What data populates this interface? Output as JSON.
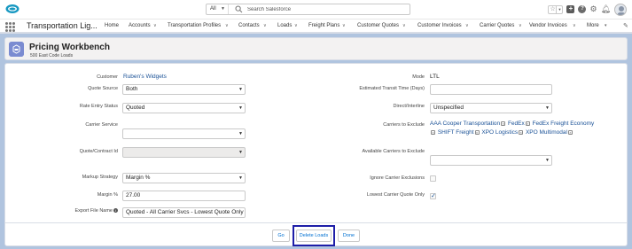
{
  "header": {
    "search_scope": "All",
    "search_placeholder": "Search Salesforce"
  },
  "nav": {
    "app_name": "Transportation Lig...",
    "items": [
      {
        "label": "Home",
        "chevron": false
      },
      {
        "label": "Accounts",
        "chevron": true
      },
      {
        "label": "Transportation Profiles",
        "chevron": true
      },
      {
        "label": "Contacts",
        "chevron": true
      },
      {
        "label": "Loads",
        "chevron": true
      },
      {
        "label": "Freight Plans",
        "chevron": true
      },
      {
        "label": "Customer Quotes",
        "chevron": true
      },
      {
        "label": "Customer Invoices",
        "chevron": true
      },
      {
        "label": "Carrier Quotes",
        "chevron": true
      },
      {
        "label": "Vendor Invoices",
        "chevron": true
      },
      {
        "label": "More",
        "chevron": true
      }
    ]
  },
  "workbench": {
    "title": "Pricing Workbench",
    "subtitle": "500 East Code Loads"
  },
  "form": {
    "customer": {
      "label": "Customer",
      "value": "Ruben's Widgets"
    },
    "quote_source": {
      "label": "Quote Source",
      "value": "Both"
    },
    "rate_entry_status": {
      "label": "Rate Entry Status",
      "value": "Quoted"
    },
    "carrier_service": {
      "label": "Carrier Service",
      "value": ""
    },
    "quote_contract_id": {
      "label": "Quote/Contract Id",
      "value": ""
    },
    "markup_strategy": {
      "label": "Markup Strategy",
      "value": "Margin %"
    },
    "margin_pct": {
      "label": "Margin %",
      "value": "27.00"
    },
    "export_file_name": {
      "label": "Export File Name",
      "value": "Quoted - All Carrier Svcs - Lowest Quote Only"
    },
    "mode": {
      "label": "Mode",
      "value": "LTL"
    },
    "estimated_transit_time": {
      "label": "Estimated Transit Time (Days)",
      "value": ""
    },
    "direct_interline": {
      "label": "Direct/Interline",
      "value": "Unspecified"
    },
    "carriers_to_exclude": {
      "label": "Carriers to Exclude",
      "items": [
        "AAA Cooper Transportation",
        "FedEx",
        "FedEx Freight Economy",
        "SHIFT Freight",
        "XPO Logistics",
        "XPO Multimodal"
      ]
    },
    "available_carriers": {
      "label": "Available Carriers to Exclude",
      "value": ""
    },
    "ignore_carrier_exclusions": {
      "label": "Ignore Carrier Exclusions",
      "checked": false
    },
    "lowest_carrier_quote_only": {
      "label": "Lowest Carrier Quote Only",
      "checked": true
    }
  },
  "buttons": {
    "go": "Go",
    "delete_loads": "Delete Loads",
    "done": "Done"
  }
}
